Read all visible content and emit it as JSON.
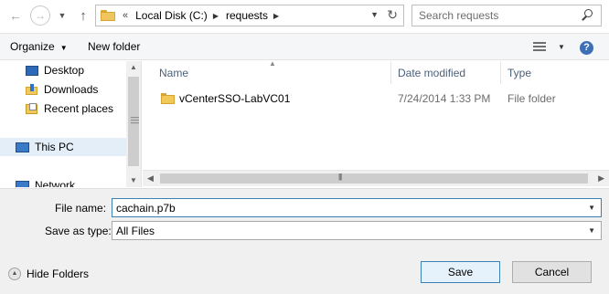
{
  "address": {
    "overflow": "«",
    "crumbs": [
      "Local Disk (C:)",
      "requests"
    ]
  },
  "search": {
    "placeholder": "Search requests"
  },
  "toolbar": {
    "organize": "Organize",
    "new_folder": "New folder"
  },
  "nav": {
    "items": [
      {
        "label": "Desktop",
        "icon": "desktop-icon"
      },
      {
        "label": "Downloads",
        "icon": "downloads-folder-icon"
      },
      {
        "label": "Recent places",
        "icon": "recent-places-icon"
      },
      {
        "label": "This PC",
        "icon": "computer-icon"
      },
      {
        "label": "Network",
        "icon": "network-icon"
      }
    ]
  },
  "list": {
    "headers": {
      "name": "Name",
      "date": "Date modified",
      "type": "Type"
    },
    "rows": [
      {
        "name": "vCenterSSO-LabVC01",
        "date": "7/24/2014 1:33 PM",
        "type": "File folder"
      }
    ]
  },
  "form": {
    "filename_label": "File name:",
    "filename_value": "cachain.p7b",
    "saveas_label": "Save as type:",
    "saveas_value": "All Files",
    "hide_folders": "Hide Folders",
    "save": "Save",
    "cancel": "Cancel"
  },
  "colors": {
    "accent": "#3c7fb1",
    "selection": "#e4eef8",
    "header_text": "#4c607a"
  }
}
